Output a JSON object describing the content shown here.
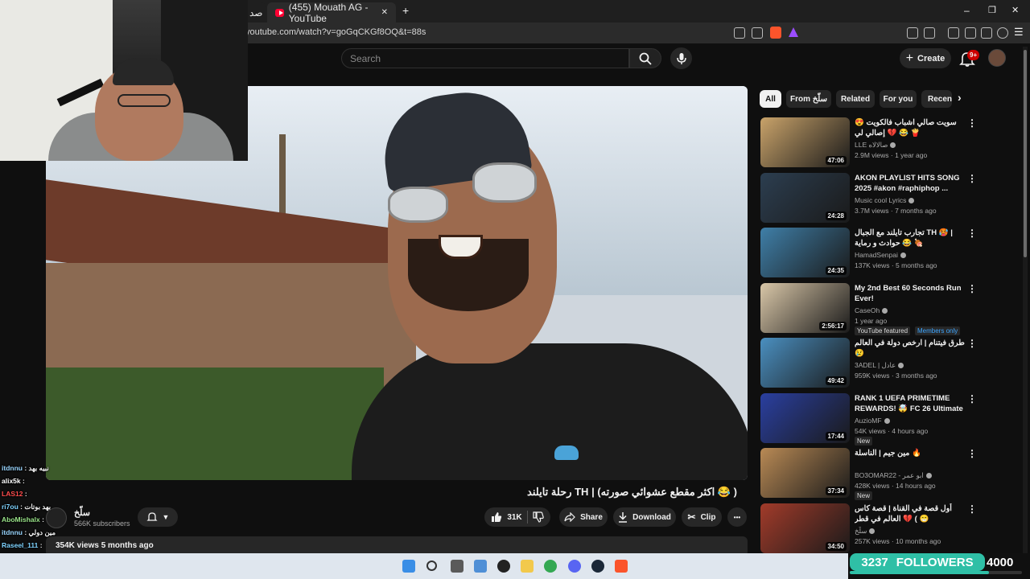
{
  "browser": {
    "tab_title": "(455) Mouath AG - YouTube",
    "partial_tab": "صد",
    "url": "youtube.com/watch?v=goGqCKGf8OQ&t=88s",
    "new_tab": "+",
    "minimize": "–",
    "restore": "❐",
    "close": "✕"
  },
  "header": {
    "search_placeholder": "Search",
    "create_label": "Create",
    "notifications_badge": "9+"
  },
  "video": {
    "title": "( 😂 اكثر مقطع عشوائي صورته) | TH رحلة تايلند",
    "channel": "سلّخ",
    "subscribers": "566K subscribers",
    "likes": "31K",
    "share": "Share",
    "download": "Download",
    "clip": "Clip",
    "more": "•••",
    "meta": "354K views  5 months ago"
  },
  "chat": [
    {
      "user": "itdnnu",
      "text": "نبيه بهد",
      "color": "#9ad6ff"
    },
    {
      "user": "alix5k",
      "text": "",
      "color": "#ffffff"
    },
    {
      "user": "LAS12",
      "text": "",
      "color": "#ff4d4d"
    },
    {
      "user": "ri7ou",
      "text": "بهد بوتات",
      "color": "#7fd3ff"
    },
    {
      "user": "AboMishalx",
      "text": "",
      "color": "#9be58a"
    },
    {
      "user": "itdnnu",
      "text": "مين دولي",
      "color": "#9ad6ff"
    },
    {
      "user": "Raseel_111",
      "text": "",
      "color": "#7fd3ff"
    },
    {
      "user": "AboMishalx",
      "text": "",
      "color": "#9be58a"
    },
    {
      "user": "AboMishalx",
      "text": "",
      "color": "#9be58a"
    }
  ],
  "chips": [
    "All",
    "From سلّخ",
    "Related",
    "For you",
    "Recen"
  ],
  "recommendations": [
    {
      "title": "سويت صالي اشباب فالكويت 😍 💔 إصالي لي 😂 🍟",
      "channel": "LLE صالالاه",
      "views": "2.9M views · 1 year ago",
      "duration": "47:06",
      "tags": []
    },
    {
      "title": "AKON PLAYLIST HITS SONG 2025 #akon #raphiphop ...",
      "channel": "Music cool Lyrics",
      "views": "3.7M views · 7 months ago",
      "duration": "24:28",
      "tags": []
    },
    {
      "title": "تجارب تايلند مع الجبال TH 🥵 | حوادث و رماية 😂 🍖",
      "channel": "HamadSenpai",
      "views": "137K views · 5 months ago",
      "duration": "24:35",
      "tags": []
    },
    {
      "title": "My 2nd Best 60 Seconds Run Ever!",
      "channel": "CaseOh",
      "views": "1 year ago",
      "duration": "2:56:17",
      "tags": [
        "YouTube featured",
        "Members only"
      ]
    },
    {
      "title": "طرق فيتنام | ارخص دولة في العالم 😢",
      "channel": "3ADEL | عادل",
      "views": "959K views · 3 months ago",
      "duration": "49:42",
      "tags": []
    },
    {
      "title": "RANK 1 UEFA PRIMETIME REWARDS! 🤯 FC 26 Ultimate ...",
      "channel": "AuzioMF",
      "views": "54K views · 4 hours ago",
      "duration": "17:44",
      "tags": [
        "New"
      ]
    },
    {
      "title": "مين جيم | الناسلة 🔥",
      "channel": "BO3OMAR22 - ابو عمر",
      "views": "428K views · 14 hours ago",
      "duration": "37:34",
      "tags": [
        "New"
      ]
    },
    {
      "title": "أول قصة في القناة | قصة كاس العالم في قطر 💔 ( 😁",
      "channel": "سلّخ",
      "views": "257K views · 10 months ago",
      "duration": "34:50",
      "tags": []
    }
  ],
  "overlay": {
    "followers_count": "3237",
    "followers_label": "FOLLOWERS",
    "followers_goal": "4000",
    "progress_fraction": 0.809
  },
  "colors": {
    "yt_red": "#ff0033",
    "accent_blue": "#3ea6ff",
    "follower_teal": "#2fbfa6"
  }
}
